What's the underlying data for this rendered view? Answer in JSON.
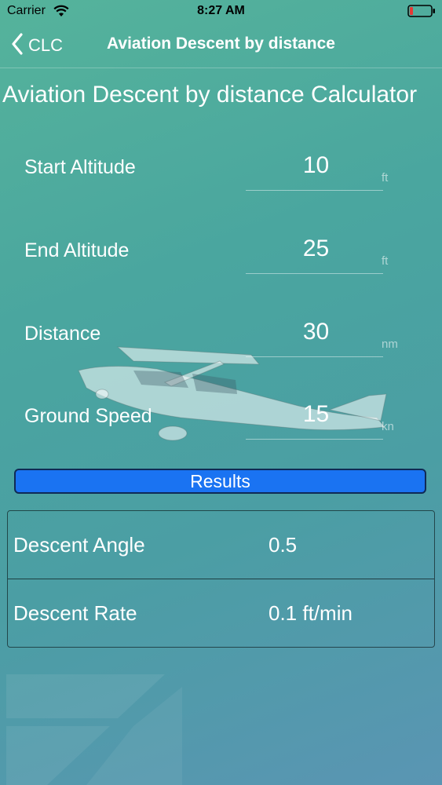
{
  "status_bar": {
    "carrier": "Carrier",
    "time": "8:27 AM",
    "icons": [
      "wifi-icon",
      "battery-icon"
    ],
    "battery_color": "#e53935"
  },
  "nav": {
    "back_label": "CLC",
    "title": "Aviation Descent by distance"
  },
  "page_title": "Aviation Descent by distance Calculator",
  "inputs": [
    {
      "label": "Start Altitude",
      "value": "10",
      "unit": "ft"
    },
    {
      "label": "End Altitude",
      "value": "25",
      "unit": "ft"
    },
    {
      "label": "Distance",
      "value": "30",
      "unit": "nm"
    },
    {
      "label": "Ground Speed",
      "value": "15",
      "unit": "kn"
    }
  ],
  "results_button": "Results",
  "results": [
    {
      "label": "Descent Angle",
      "value": "0.5"
    },
    {
      "label": "Descent Rate",
      "value": "0.1 ft/min"
    }
  ],
  "colors": {
    "accent_button": "#1a73f2",
    "background_top": "#55b39b",
    "background_bottom": "#5a95b3"
  }
}
